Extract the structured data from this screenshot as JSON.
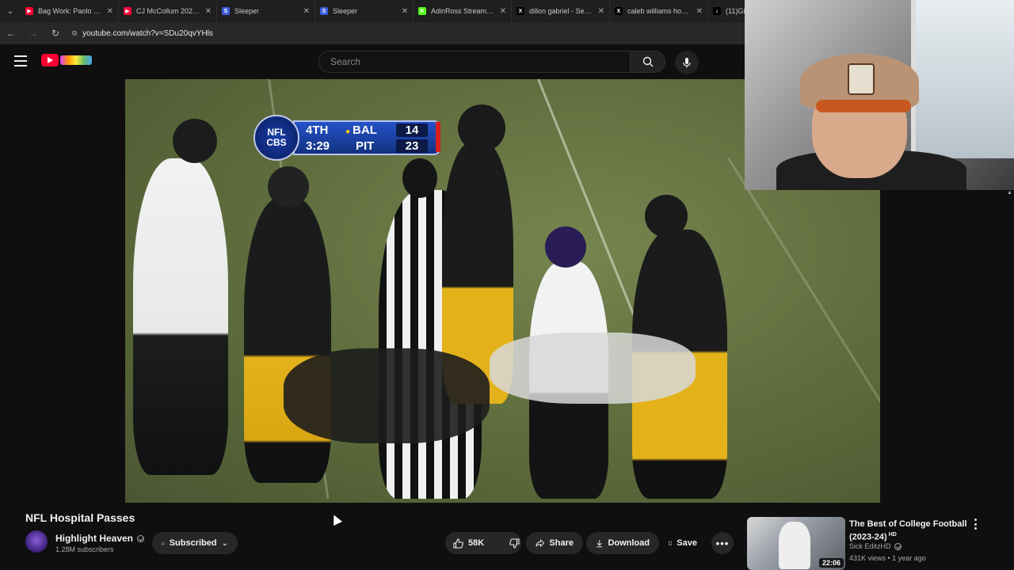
{
  "browser": {
    "tabs": [
      {
        "label": "Bag Work: Paolo Ban",
        "fav_color": "#ff0033",
        "fav_glyph": "▶"
      },
      {
        "label": "CJ McCollum 2024-2",
        "fav_color": "#ff0033",
        "fav_glyph": "▶"
      },
      {
        "label": "Sleeper",
        "fav_color": "#3b5bdb",
        "fav_glyph": "S"
      },
      {
        "label": "Sleeper",
        "fav_color": "#3b5bdb",
        "fav_glyph": "S"
      },
      {
        "label": "AdinRoss Stream - W",
        "fav_color": "#53fc18",
        "fav_glyph": "K"
      },
      {
        "label": "dillon gabriel - Searc",
        "fav_color": "#000000",
        "fav_glyph": "X"
      },
      {
        "label": "caleb williams hospit",
        "fav_color": "#000000",
        "fav_glyph": "X"
      },
      {
        "label": "(11)Gilb",
        "fav_color": "#000000",
        "fav_glyph": "♪"
      }
    ],
    "url": "youtube.com/watch?v=SDu20qvYHls"
  },
  "header": {
    "search_placeholder": "Search"
  },
  "scorebug": {
    "network_top": "NFL",
    "network_bottom": "CBS",
    "quarter": "4TH",
    "clock": "3:29",
    "team_away": "BAL",
    "score_away": "14",
    "team_home": "PIT",
    "score_home": "23"
  },
  "video": {
    "title": "NFL Hospital Passes",
    "channel": "Highlight Heaven",
    "subscribers": "1.28M subscribers",
    "subscribe_label": "Subscribed",
    "likes": "58K",
    "share_label": "Share",
    "download_label": "Download",
    "save_label": "Save"
  },
  "recommended": {
    "title": "The Best of College Football (2023-24)",
    "hd": "HD",
    "channel": "Sick EditzHD",
    "meta": "431K views • 1 year ago",
    "duration": "22:06"
  },
  "colors": {
    "youtube_red": "#ff0033",
    "background": "#0f0f0f",
    "pill": "#272727"
  }
}
